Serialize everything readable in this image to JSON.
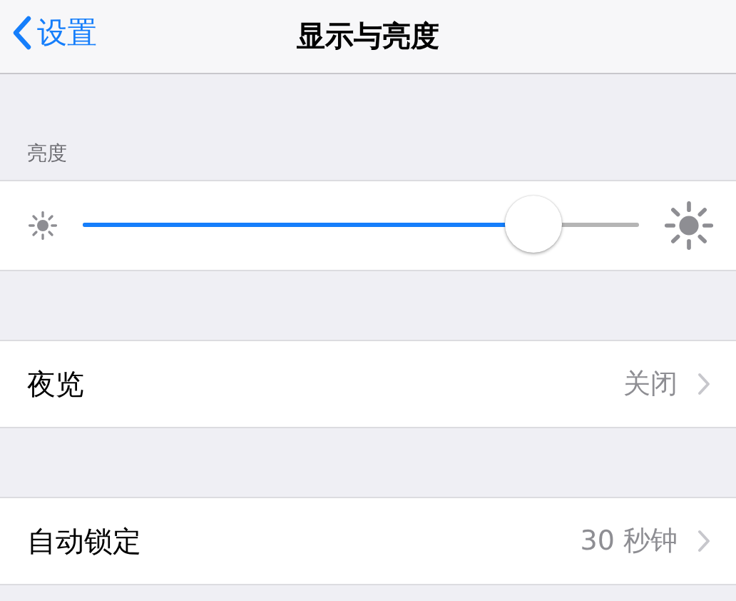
{
  "navigation": {
    "back": "设置",
    "title": "显示与亮度"
  },
  "brightness": {
    "header": "亮度",
    "level": 0.845
  },
  "rows": [
    {
      "label": "夜览",
      "value": "关闭"
    },
    {
      "label": "自动锁定",
      "value": "30 秒钟"
    }
  ]
}
